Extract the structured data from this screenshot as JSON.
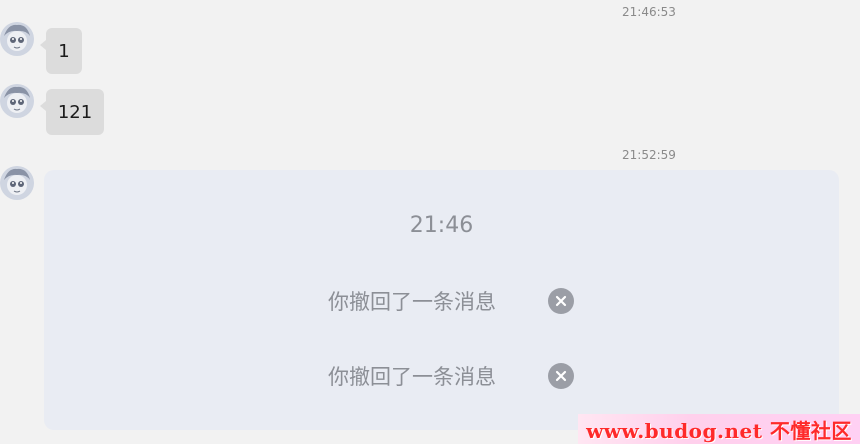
{
  "chat": {
    "timestamps": {
      "first": "21:46:53",
      "second": "21:52:59"
    },
    "messages": [
      {
        "text": "1"
      },
      {
        "text": "121"
      }
    ],
    "recall_card": {
      "time": "21:46",
      "items": [
        {
          "text": "你撤回了一条消息",
          "icon": "close-icon"
        },
        {
          "text": "你撤回了一条消息",
          "icon": "close-icon"
        }
      ]
    }
  },
  "watermark": {
    "text": "www.budog.net 不懂社区"
  },
  "colors": {
    "background": "#f2f2f2",
    "bubble": "#dcdcdc",
    "card": "#e9ecf3",
    "muted_text": "#8c8f96",
    "close_icon_bg": "#9b9ea6",
    "watermark_text": "#ff2a2a"
  }
}
